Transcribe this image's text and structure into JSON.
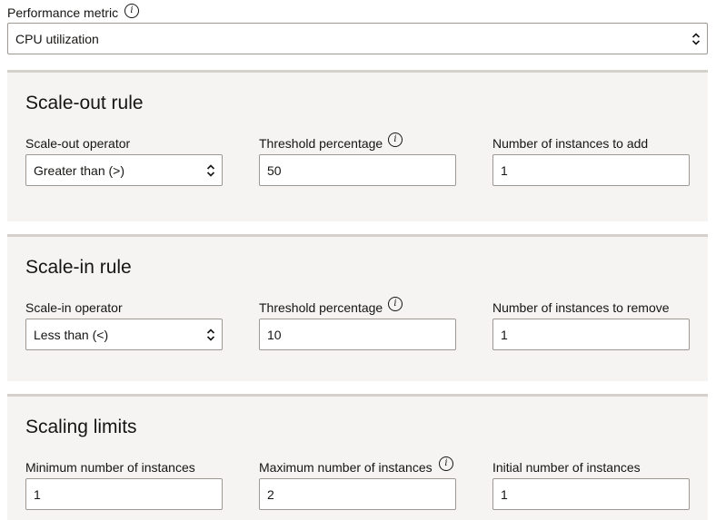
{
  "performance_metric": {
    "label": "Performance metric",
    "value": "CPU utilization"
  },
  "scale_out": {
    "title": "Scale-out rule",
    "operator_label": "Scale-out operator",
    "operator_value": "Greater than (>)",
    "threshold_label": "Threshold percentage",
    "threshold_value": "50",
    "instances_label": "Number of instances to add",
    "instances_value": "1"
  },
  "scale_in": {
    "title": "Scale-in rule",
    "operator_label": "Scale-in operator",
    "operator_value": "Less than (<)",
    "threshold_label": "Threshold percentage",
    "threshold_value": "10",
    "instances_label": "Number of instances to remove",
    "instances_value": "1"
  },
  "scaling_limits": {
    "title": "Scaling limits",
    "min_label": "Minimum number of instances",
    "min_value": "1",
    "max_label": "Maximum number of instances",
    "max_value": "2",
    "initial_label": "Initial number of instances",
    "initial_value": "1"
  },
  "icons": {
    "info": "i"
  }
}
